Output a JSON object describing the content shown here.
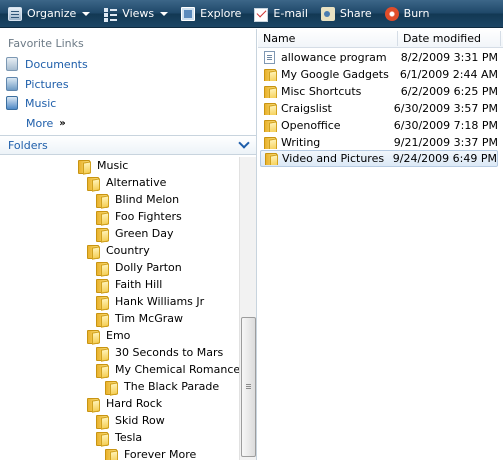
{
  "toolbar": {
    "organize": "Organize",
    "views": "Views",
    "explore": "Explore",
    "email": "E-mail",
    "share": "Share",
    "burn": "Burn"
  },
  "favorites": {
    "title": "Favorite Links",
    "items": [
      "Documents",
      "Pictures",
      "Music"
    ],
    "more": "More",
    "more_arrow": "»"
  },
  "folders": {
    "title": "Folders",
    "tree": [
      {
        "label": "Music",
        "level": 0
      },
      {
        "label": "Alternative",
        "level": 1
      },
      {
        "label": "Blind Melon",
        "level": 2
      },
      {
        "label": "Foo Fighters",
        "level": 2
      },
      {
        "label": "Green Day",
        "level": 2
      },
      {
        "label": "Country",
        "level": 1
      },
      {
        "label": "Dolly Parton",
        "level": 2
      },
      {
        "label": "Faith Hill",
        "level": 2
      },
      {
        "label": "Hank Williams Jr",
        "level": 2
      },
      {
        "label": "Tim McGraw",
        "level": 2
      },
      {
        "label": "Emo",
        "level": 1
      },
      {
        "label": "30 Seconds to Mars",
        "level": 2
      },
      {
        "label": "My Chemical Romance",
        "level": 2
      },
      {
        "label": "The Black Parade",
        "level": 3
      },
      {
        "label": "Hard Rock",
        "level": 1
      },
      {
        "label": "Skid Row",
        "level": 2
      },
      {
        "label": "Tesla",
        "level": 2
      },
      {
        "label": "Forever More",
        "level": 3
      }
    ]
  },
  "file_list": {
    "columns": [
      "Name",
      "Date modified"
    ],
    "rows": [
      {
        "name": "allowance program",
        "date": "8/2/2009 3:31 PM",
        "type": "document",
        "selected": false
      },
      {
        "name": "My Google Gadgets",
        "date": "6/1/2009 2:44 AM",
        "type": "folder",
        "selected": false
      },
      {
        "name": "Misc Shortcuts",
        "date": "6/2/2009 6:25 PM",
        "type": "folder",
        "selected": false
      },
      {
        "name": "Craigslist",
        "date": "6/30/2009 3:57 PM",
        "type": "folder",
        "selected": false
      },
      {
        "name": "Openoffice",
        "date": "6/30/2009 7:18 PM",
        "type": "folder",
        "selected": false
      },
      {
        "name": "Writing",
        "date": "9/21/2009 3:37 PM",
        "type": "folder",
        "selected": false
      },
      {
        "name": "Video and Pictures",
        "date": "9/24/2009 6:49 PM",
        "type": "folder",
        "selected": true
      }
    ]
  },
  "colors": {
    "link_blue": "#1e5eaa",
    "toolbar_dark": "#1f4869",
    "folder_yellow": "#f5cf56"
  }
}
